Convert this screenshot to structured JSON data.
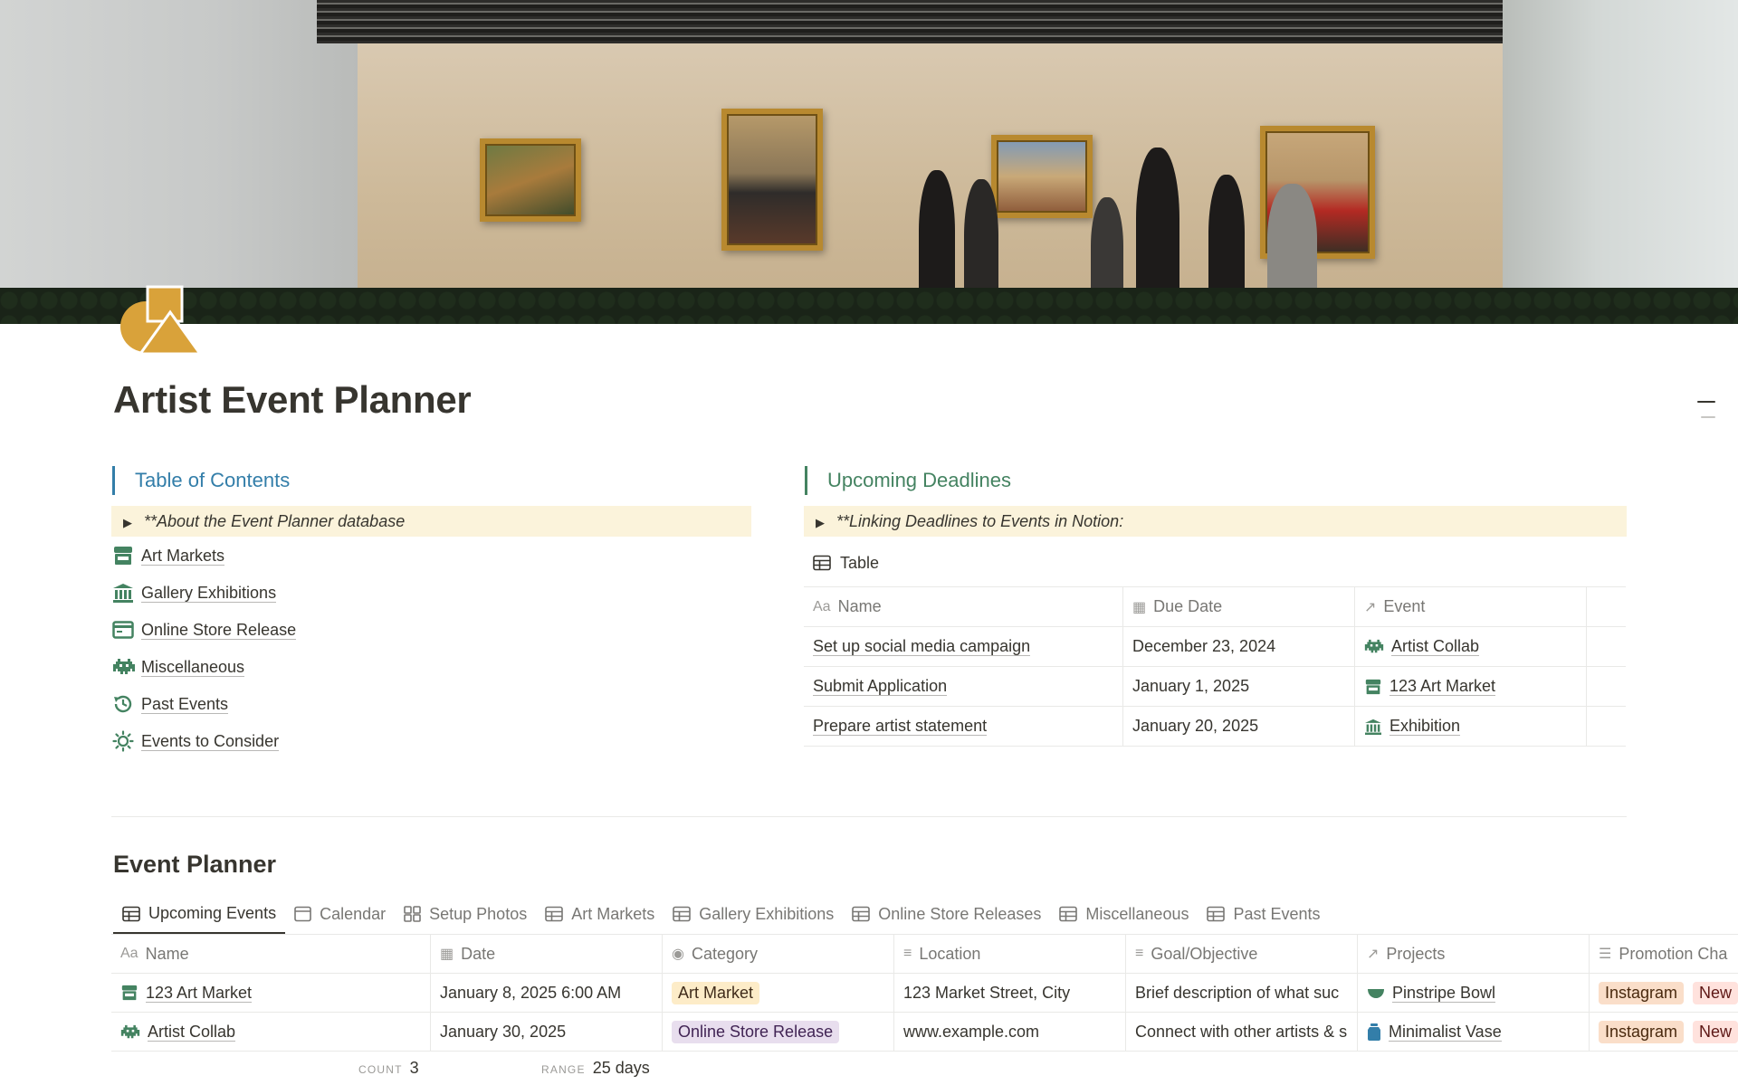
{
  "page": {
    "title": "Artist Event Planner"
  },
  "toc": {
    "heading": "Table of Contents",
    "toggle": "**About the Event Planner database",
    "items": [
      {
        "label": "Art Markets",
        "icon": "storefront-icon"
      },
      {
        "label": "Gallery Exhibitions",
        "icon": "museum-icon"
      },
      {
        "label": "Online Store Release",
        "icon": "browser-window-icon"
      },
      {
        "label": "Miscellaneous",
        "icon": "space-invader-icon"
      },
      {
        "label": "Past Events",
        "icon": "history-icon"
      },
      {
        "label": "Events to Consider",
        "icon": "sun-icon"
      }
    ]
  },
  "deadlines": {
    "heading": "Upcoming Deadlines",
    "toggle": "**Linking Deadlines to Events in Notion:",
    "view_label": "Table",
    "columns": [
      "Name",
      "Due Date",
      "Event"
    ],
    "rows": [
      {
        "name": "Set up social media campaign",
        "due": "December 23, 2024",
        "event": "Artist Collab",
        "event_icon": "space-invader-icon"
      },
      {
        "name": "Submit Application",
        "due": "January 1, 2025",
        "event": "123 Art Market",
        "event_icon": "storefront-icon"
      },
      {
        "name": "Prepare artist statement",
        "due": "January 20, 2025",
        "event": "Exhibition",
        "event_icon": "museum-icon"
      }
    ]
  },
  "planner": {
    "title": "Event Planner",
    "tabs": [
      "Upcoming Events",
      "Calendar",
      "Setup Photos",
      "Art Markets",
      "Gallery Exhibitions",
      "Online Store Releases",
      "Miscellaneous",
      "Past Events"
    ],
    "active_tab": "Upcoming Events",
    "columns": [
      "Name",
      "Date",
      "Category",
      "Location",
      "Goal/Objective",
      "Projects",
      "Promotion Cha"
    ],
    "rows": [
      {
        "name": "123 Art Market",
        "name_icon": "storefront-icon",
        "date": "January 8, 2025 6:00 AM",
        "category": "Art Market",
        "location": "123 Market Street, City",
        "goal": "Brief description of what suc",
        "project": "Pinstripe Bowl",
        "project_icon": "bowl-icon",
        "promo": [
          "Instagram",
          "New"
        ]
      },
      {
        "name": "Artist Collab",
        "name_icon": "space-invader-icon",
        "date": "January 30, 2025",
        "category": "Online Store Release",
        "location": "www.example.com",
        "goal": "Connect with other artists & s",
        "project": "Minimalist Vase",
        "project_icon": "vase-icon",
        "promo": [
          "Instagram",
          "New"
        ]
      }
    ],
    "footer": {
      "count_label": "COUNT",
      "count": "3",
      "range_label": "RANGE",
      "range": "25 days"
    }
  },
  "colors": {
    "accent_blue": "#337ea9",
    "deadline_green": "#448361",
    "icon_green": "#448361",
    "callout_bg": "#fbf3db",
    "tag_art_market": "#fdecc8",
    "tag_online_store": "#e8deee",
    "tag_instagram": "#fadec9",
    "tag_new": "#ffe2dd"
  }
}
